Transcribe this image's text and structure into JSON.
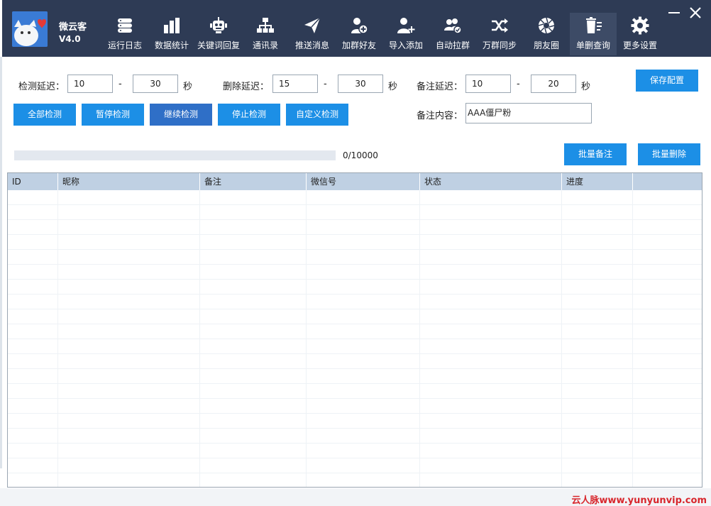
{
  "app": {
    "name": "微云客",
    "version": "V4.0"
  },
  "nav": [
    {
      "label": "运行日志",
      "icon": "server-icon"
    },
    {
      "label": "数据统计",
      "icon": "bar-chart-icon"
    },
    {
      "label": "关键词回复",
      "icon": "robot-icon"
    },
    {
      "label": "通讯录",
      "icon": "org-chart-icon"
    },
    {
      "label": "推送消息",
      "icon": "paper-plane-icon"
    },
    {
      "label": "加群好友",
      "icon": "user-add-circle-icon"
    },
    {
      "label": "导入添加",
      "icon": "user-plus-icon"
    },
    {
      "label": "自动拉群",
      "icon": "group-check-icon"
    },
    {
      "label": "万群同步",
      "icon": "shuffle-icon"
    },
    {
      "label": "朋友圈",
      "icon": "aperture-icon"
    },
    {
      "label": "单删查询",
      "icon": "trash-list-icon",
      "active": true
    },
    {
      "label": "更多设置",
      "icon": "gear-icon"
    }
  ],
  "settings": {
    "detect_delay_label": "检测延迟：",
    "detect_min": "10",
    "detect_max": "30",
    "delete_delay_label": "删除延迟：",
    "delete_min": "15",
    "delete_max": "30",
    "remark_delay_label": "备注延迟：",
    "remark_min": "10",
    "remark_max": "20",
    "dash": "-",
    "seconds": "秒",
    "remark_content_label": "备注内容：",
    "remark_content": "AAA僵尸粉"
  },
  "buttons": {
    "save": "保存配置",
    "all_detect": "全部检测",
    "pause": "暂停检测",
    "resume": "继续检测",
    "stop": "停止检测",
    "custom": "自定义检测",
    "batch_remark": "批量备注",
    "batch_delete": "批量删除"
  },
  "progress": {
    "text": "0/10000",
    "fraction": 0
  },
  "table": {
    "columns": [
      "ID",
      "昵称",
      "备注",
      "微信号",
      "状态",
      "进度",
      ""
    ]
  },
  "watermark": "云人脉www.yunyunvip.com"
}
